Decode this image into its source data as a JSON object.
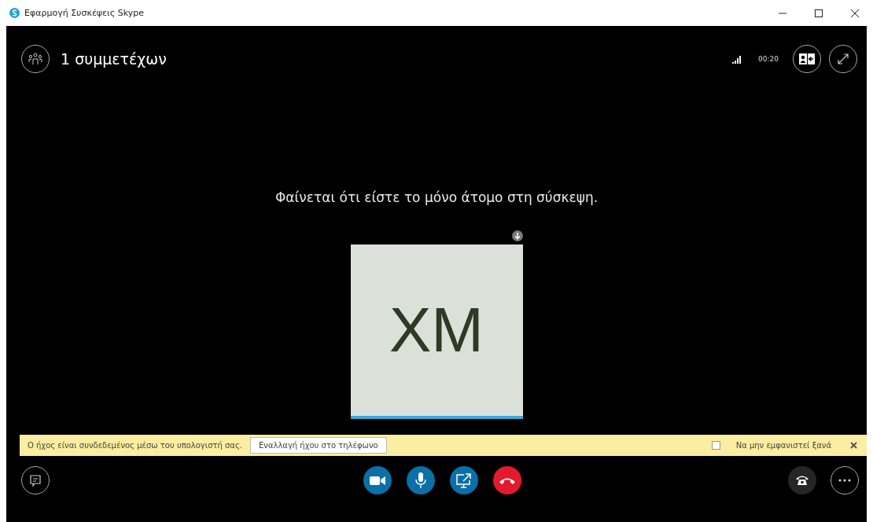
{
  "window": {
    "title": "Εφαρμογή Συσκέψεις Skype"
  },
  "header": {
    "participants": "1 συμμετέχων",
    "duration": "00:20"
  },
  "message": "Φαίνεται ότι είστε το μόνο άτομο στη σύσκεψη.",
  "tile": {
    "initials": "XM",
    "speaking": true
  },
  "banner": {
    "text": "Ο ήχος είναι συνδεδεμένος μέσω του υπολογιστή σας.",
    "button": "Εναλλαγή ήχου στο τηλέφωνο",
    "dont_show": {
      "label": "Να μην εμφανιστεί ξανά",
      "checked": false
    }
  },
  "controls": [
    {
      "kind": "video"
    },
    {
      "kind": "mic"
    },
    {
      "kind": "share"
    },
    {
      "kind": "hangup"
    }
  ]
}
